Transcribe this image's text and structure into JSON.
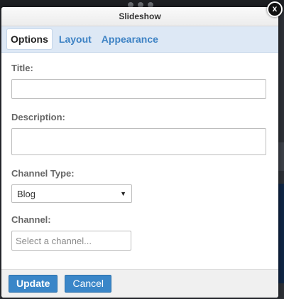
{
  "dialog": {
    "title": "Slideshow",
    "close_label": "x"
  },
  "tabs": [
    {
      "label": "Options",
      "active": true
    },
    {
      "label": "Layout",
      "active": false
    },
    {
      "label": "Appearance",
      "active": false
    }
  ],
  "form": {
    "title_label": "Title:",
    "title_value": "",
    "description_label": "Description:",
    "description_value": "",
    "channel_type_label": "Channel Type:",
    "channel_type_value": "Blog",
    "channel_label": "Channel:",
    "channel_placeholder": "Select a channel..."
  },
  "footer": {
    "update_label": "Update",
    "cancel_label": "Cancel"
  },
  "colors": {
    "accent": "#3a86c8",
    "tab_bar": "#dde8f5",
    "tab_link": "#3d82c4",
    "label": "#666666"
  },
  "icons": {
    "close": "close-icon",
    "dropdown": "chevron-down-icon"
  }
}
